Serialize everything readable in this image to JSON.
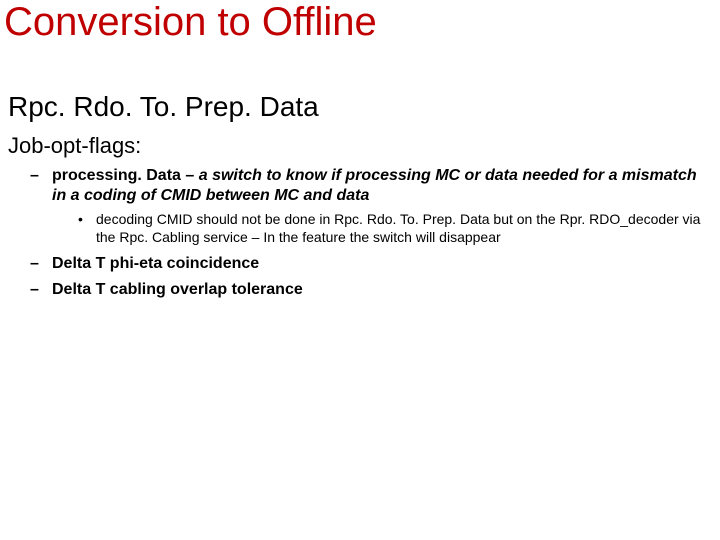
{
  "title": "Conversion to Offline",
  "subtitle": "Rpc. Rdo. To. Prep. Data",
  "section": "Job-opt-flags:",
  "bullets": {
    "b1_lead": "processing. Data",
    "b1_sep": " – ",
    "b1_rest": "a switch to know if processing MC or data needed for a mismatch in a coding of CMID between MC and data",
    "b1_sub_a": "decoding CMID should not be done in Rpc. Rdo. To. Prep. Data but on the Rpr. RDO_decoder via the Rpc. Cabling service – ",
    "b1_sub_a_tail": "In the feature the switch will disappear",
    "b2": "Delta T phi-eta coincidence",
    "b3": "Delta T cabling overlap tolerance"
  }
}
